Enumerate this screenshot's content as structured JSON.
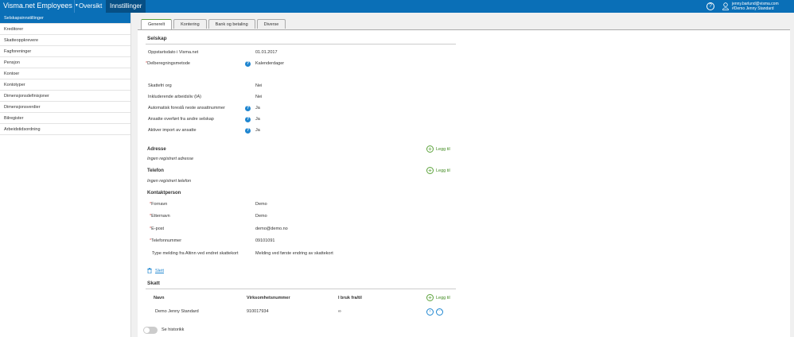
{
  "topbar": {
    "brand": "Visma.net Employees",
    "nav": [
      "Oversikt",
      "Innstillinger"
    ],
    "help_symbol": "?",
    "user_email": "jenny.barlund@visma.com",
    "user_company": "#Demo Jenny Standard"
  },
  "sidebar": {
    "items": [
      "Selskapsinnstillinger",
      "Kreditorer",
      "Skatteoppkrevere",
      "Fagforeninger",
      "Pensjon",
      "Kontoer",
      "Kontotyper",
      "Dimensjonsdefinisjoner",
      "Dimensjonsverdier",
      "Bilregister",
      "Arbeidstidsordning"
    ]
  },
  "tabs": [
    "Generelt",
    "Kontering",
    "Bank og betaling",
    "Diverse"
  ],
  "selskap": {
    "title": "Selskap",
    "fields": [
      {
        "label": "Oppstartsdato i Visma.net",
        "value": "01.01.2017"
      },
      {
        "label": "Delberegningsmetode",
        "value": "Kalenderdager",
        "required": "*"
      },
      {
        "label": "Skattefri org",
        "value": "Nei"
      },
      {
        "label": "Inkluderende arbeidsliv (IA)",
        "value": "Nei"
      },
      {
        "label": "Automatisk foreslå neste ansattnummer",
        "value": "Ja"
      },
      {
        "label": "Ansatte overført fra andre selskap",
        "value": "Ja"
      },
      {
        "label": "Aktiver import av ansatte",
        "value": "Ja"
      }
    ]
  },
  "adresse": {
    "title": "Adresse",
    "empty": "Ingen registrert adresse",
    "add": "Legg til"
  },
  "telefon": {
    "title": "Telefon",
    "empty": "Ingen registrert telefon",
    "add": "Legg til"
  },
  "kontakt": {
    "title": "Kontaktperson",
    "fields": [
      {
        "label": "Fornavn",
        "value": "Demo"
      },
      {
        "label": "Etternavn",
        "value": "Demo"
      },
      {
        "label": "E-post",
        "value": "demo@demo.no"
      },
      {
        "label": "Telefonnummer",
        "value": "09101091"
      },
      {
        "label": "Type melding fra Altinn ved endret skattekort",
        "value": "Melding ved første endring av skattekort"
      }
    ],
    "delete": "Slett"
  },
  "skatt": {
    "title": "Skatt",
    "columns": [
      "Navn",
      "Virksomhetsnummer",
      "I bruk fra/til"
    ],
    "add": "Legg til",
    "rows": [
      {
        "navn": "Demo Jenny Standard",
        "nummer": "910017934",
        "bruk": "∞"
      }
    ]
  },
  "historikk": "Se historikk",
  "colors": {
    "primary": "#0a6fb7",
    "accent_green": "#5ca33b",
    "required": "#d9534f"
  }
}
